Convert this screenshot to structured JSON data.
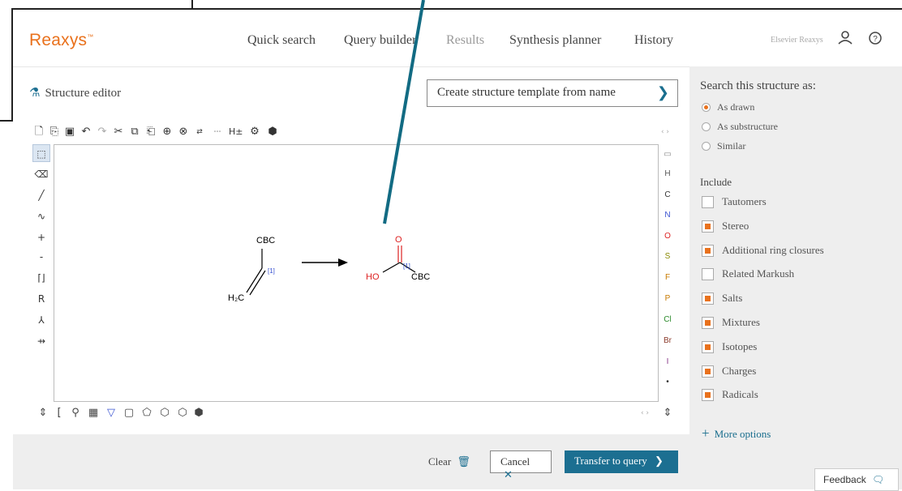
{
  "header": {
    "logo": "Reaxys",
    "nav": [
      "Quick search",
      "Query builder",
      "Results",
      "Synthesis planner",
      "History"
    ],
    "brand_user": "Elsevier Reaxys"
  },
  "editor": {
    "title": "Structure editor",
    "template_button": "Create structure template from name",
    "atoms": [
      "H",
      "C",
      "N",
      "O",
      "S",
      "F",
      "P",
      "Cl",
      "Br",
      "I",
      "•"
    ]
  },
  "reaction": {
    "reactant_group": "CBC",
    "reactant_ch2": "H₂C",
    "reactant_map": "[1]",
    "product_o": "O",
    "product_ho": "HO",
    "product_map": "[1]",
    "product_group": "CBC"
  },
  "sidebar": {
    "search_as_title": "Search this structure as:",
    "search_options": [
      {
        "label": "As drawn",
        "selected": true
      },
      {
        "label": "As substructure",
        "selected": false
      },
      {
        "label": "Similar",
        "selected": false
      }
    ],
    "include_title": "Include",
    "include_options": [
      {
        "label": "Tautomers",
        "checked": false
      },
      {
        "label": "Stereo",
        "checked": true
      },
      {
        "label": "Additional ring closures",
        "checked": true
      },
      {
        "label": "Related Markush",
        "checked": false
      },
      {
        "label": "Salts",
        "checked": true
      },
      {
        "label": "Mixtures",
        "checked": true
      },
      {
        "label": "Isotopes",
        "checked": true
      },
      {
        "label": "Charges",
        "checked": true
      },
      {
        "label": "Radicals",
        "checked": true
      }
    ],
    "more_options": "More options",
    "feedback": "Feedback"
  },
  "footer": {
    "clear": "Clear",
    "cancel": "Cancel",
    "transfer": "Transfer to query"
  },
  "colors": {
    "accent": "#e9711c",
    "primary": "#1c6f91",
    "panel": "#eeeeee"
  }
}
